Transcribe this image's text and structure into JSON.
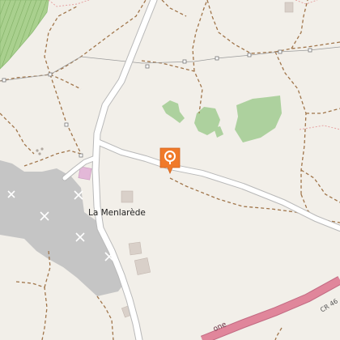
{
  "map": {
    "place_label": "La Menlarède",
    "road_ref": "CR 46",
    "road_name_fragment": "one",
    "marker": {
      "icon": "location-pin-icon",
      "color": "#f07a2a"
    },
    "colors": {
      "background": "#f2efe9",
      "forest": "#add19e",
      "industrial": "#c5c5c5",
      "main_road_fill": "#ffffff",
      "main_road_casing": "#b8b8b8",
      "highway": "#e0869b",
      "path": "#a0754a",
      "boundary": "#e6a3a3",
      "vineyard": "#a9d08e"
    }
  }
}
